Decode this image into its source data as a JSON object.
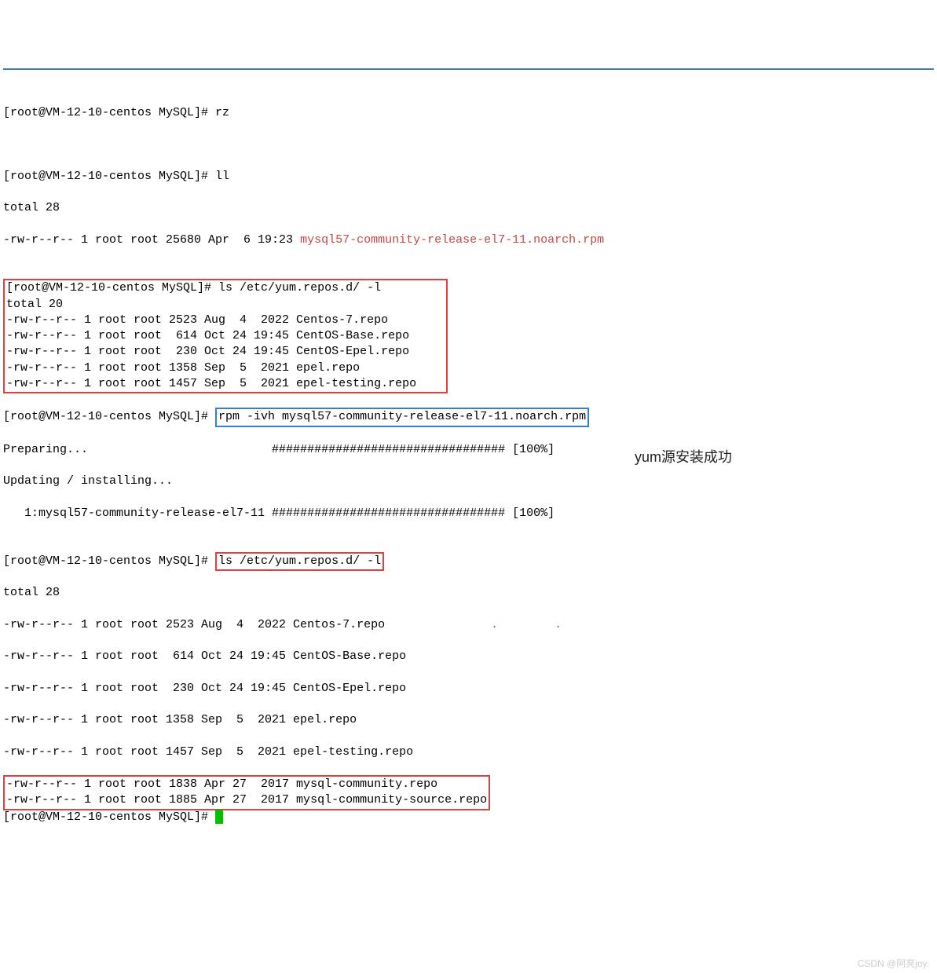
{
  "prompt": "[root@VM-12-10-centos MySQL]# ",
  "cmd_rz": "rz",
  "cmd_ll": "ll",
  "cmd_ls_repo": "ls /etc/yum.repos.d/ -l",
  "cmd_rpm": "rpm -ivh mysql57-community-release-el7-11.noarch.rpm",
  "ll_output": {
    "total": "total 28",
    "file": "-rw-r--r-- 1 root root 25680 Apr  6 19:23 ",
    "file_name": "mysql57-community-release-el7-11.noarch.rpm"
  },
  "ls1": {
    "total": "total 20",
    "l1": "-rw-r--r-- 1 root root 2523 Aug  4  2022 Centos-7.repo",
    "l2": "-rw-r--r-- 1 root root  614 Oct 24 19:45 CentOS-Base.repo",
    "l3": "-rw-r--r-- 1 root root  230 Oct 24 19:45 CentOS-Epel.repo",
    "l4": "-rw-r--r-- 1 root root 1358 Sep  5  2021 epel.repo",
    "l5": "-rw-r--r-- 1 root root 1457 Sep  5  2021 epel-testing.repo"
  },
  "rpm_out": {
    "l1": "Preparing...                          ################################# [100%]",
    "l2": "Updating / installing...",
    "l3": "   1:mysql57-community-release-el7-11 ################################# [100%]"
  },
  "ls2": {
    "total": "total 28",
    "l1": "-rw-r--r-- 1 root root 2523 Aug  4  2022 Centos-7.repo",
    "l2": "-rw-r--r-- 1 root root  614 Oct 24 19:45 CentOS-Base.repo",
    "l3": "-rw-r--r-- 1 root root  230 Oct 24 19:45 CentOS-Epel.repo",
    "l4": "-rw-r--r-- 1 root root 1358 Sep  5  2021 epel.repo",
    "l5": "-rw-r--r-- 1 root root 1457 Sep  5  2021 epel-testing.repo",
    "l6": "-rw-r--r-- 1 root root 1838 Apr 27  2017 mysql-community.repo       ",
    "l7": "-rw-r--r-- 1 root root 1885 Apr 27  2017 mysql-community-source.repo"
  },
  "annotation": "yum源安装成功",
  "red_dots": ".        .",
  "watermark": "CSDN @阿亮joy."
}
